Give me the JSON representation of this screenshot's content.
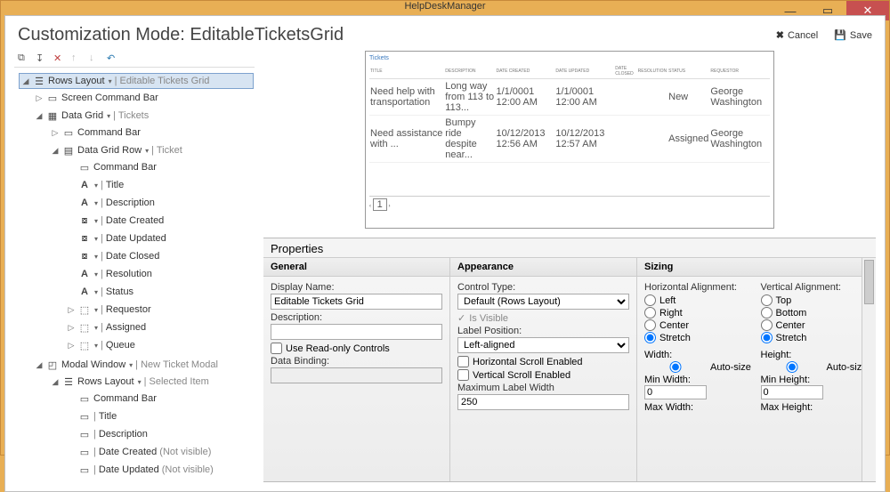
{
  "window": {
    "title": "HelpDeskManager"
  },
  "header": {
    "mode": "Customization Mode: EditableTicketsGrid",
    "cancel": "Cancel",
    "save": "Save"
  },
  "toolbar": {
    "add": "add",
    "import": "import",
    "delete": "delete",
    "up": "up",
    "down": "down",
    "undo": "undo"
  },
  "tree": {
    "root": {
      "label": "Rows Layout",
      "sub": "Editable Tickets Grid"
    },
    "screenCommandBar": "Screen Command Bar",
    "dataGrid": {
      "label": "Data Grid",
      "sub": "Tickets"
    },
    "commandBar1": "Command Bar",
    "dataGridRow": {
      "label": "Data Grid Row",
      "sub": "Ticket"
    },
    "commandBar2": "Command Bar",
    "items": [
      {
        "label": "Title"
      },
      {
        "label": "Description"
      },
      {
        "label": "Date Created"
      },
      {
        "label": "Date Updated"
      },
      {
        "label": "Date Closed"
      },
      {
        "label": "Resolution"
      },
      {
        "label": "Status"
      },
      {
        "label": "Requestor"
      },
      {
        "label": "Assigned"
      },
      {
        "label": "Queue"
      }
    ],
    "modal": {
      "label": "Modal Window",
      "sub": "New Ticket Modal"
    },
    "rows2": {
      "label": "Rows Layout",
      "sub": "Selected Item"
    },
    "commandBar3": "Command Bar",
    "items2": [
      {
        "label": "Title"
      },
      {
        "label": "Description"
      },
      {
        "label": "Date Created",
        "note": "(Not visible)"
      },
      {
        "label": "Date Updated",
        "note": "(Not visible)"
      }
    ]
  },
  "preview": {
    "title": "Tickets",
    "cols": [
      "TITLE",
      "DESCRIPTION",
      "DATE CREATED",
      "DATE UPDATED",
      "DATE CLOSED",
      "RESOLUTION",
      "STATUS",
      "REQUESTOR"
    ],
    "rows": [
      [
        "Need help with transportation",
        "Long way from 113 to 113...",
        "1/1/0001 12:00 AM",
        "1/1/0001 12:00 AM",
        "",
        "",
        "New",
        "George Washington"
      ],
      [
        "Need assistance with ...",
        "Bumpy ride despite near...",
        "10/12/2013 12:56 AM",
        "10/12/2013 12:57 AM",
        "",
        "",
        "Assigned",
        "George Washington"
      ]
    ],
    "page": "1"
  },
  "props": {
    "title": "Properties",
    "general": {
      "title": "General",
      "displayNameLabel": "Display Name:",
      "displayName": "Editable Tickets Grid",
      "descriptionLabel": "Description:",
      "description": "",
      "readonly": "Use Read-only Controls",
      "dataBindingLabel": "Data Binding:",
      "dataBinding": ""
    },
    "appearance": {
      "title": "Appearance",
      "controlTypeLabel": "Control Type:",
      "controlType": "Default (Rows Layout)",
      "isVisible": "Is Visible",
      "labelPosLabel": "Label Position:",
      "labelPos": "Left-aligned",
      "hscroll": "Horizontal Scroll Enabled",
      "vscroll": "Vertical Scroll Enabled",
      "maxLabelWidthLabel": "Maximum Label Width",
      "maxLabelWidth": "250"
    },
    "sizing": {
      "title": "Sizing",
      "halign": "Horizontal Alignment:",
      "valign": "Vertical Alignment:",
      "ha": [
        "Left",
        "Right",
        "Center",
        "Stretch"
      ],
      "va": [
        "Top",
        "Bottom",
        "Center",
        "Stretch"
      ],
      "haSel": "Stretch",
      "vaSel": "Stretch",
      "widthLabel": "Width:",
      "heightLabel": "Height:",
      "auto": "Auto-size",
      "minW": "Min Width:",
      "minH": "Min Height:",
      "maxW": "Max Width:",
      "maxH": "Max Height:",
      "minWVal": "0",
      "minHVal": "0"
    }
  }
}
